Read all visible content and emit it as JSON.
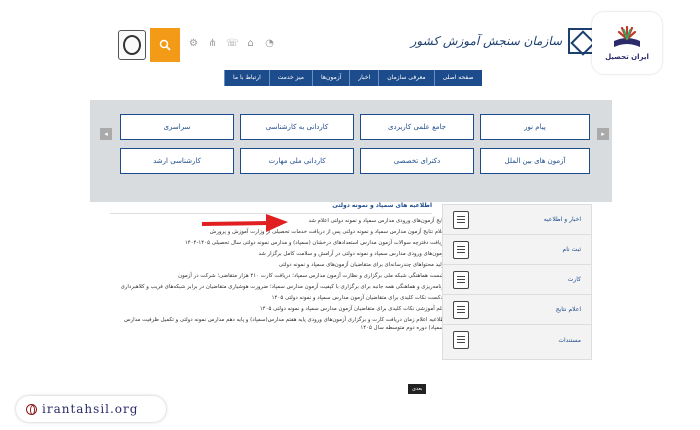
{
  "brand": {
    "name": "ایران تحصیل",
    "url": "irantahsil.org"
  },
  "header": {
    "logo_text": "سازمان سنجش آموزش کشور"
  },
  "nav": [
    "صفحه اصلی",
    "معرفی سازمان",
    "اخبار",
    "آزمون‌ها",
    "میز خدمت",
    "ارتباط با ما"
  ],
  "tiles": [
    [
      "پیام نور",
      "جامع علمی کاربردی",
      "کاردانی به کارشناسی",
      "سراسری"
    ],
    [
      "آزمون های بین الملل",
      "دکترای تخصصی",
      "کاردانی ملی مهارت",
      "کارشناسی ارشد"
    ]
  ],
  "section_title": "اطلاعیه های سمپاد و نمونه دولتی",
  "news": [
    "نتایج آزمون‌های ورودی مدارس سمپاد و نمونه دولتی اعلام شد",
    "اعلام نتایج آزمون مدارس سمپاد و نمونه دولتی پس از دریافت خدمات تحصیلی از وزارت آموزش و پرورش",
    "دریافت دفترچه سوالات آزمون مدارس استعدادهای درخشان (سمپاد) و مدارس نمونه دولتی سال تحصیلی ۱۴۰۵-۱۴۰۴",
    "آزمون‌های ورودی مدارس سمپاد و نمونه دولتی در آرامش و سلامت کامل برگزار شد",
    "تولید محتواهای چندرسانه‌ای برای متقاضیان آزمون‌های سمپاد و نمونه دولتی",
    "نشست هماهنگی شبکه ملی برگزاری و نظارت آزمون مدارس سمپاد؛ دریافت کارت ۴۱۰ هزار متقاضی؛ شرکت در آزمون",
    "برنامه‌ریزی و هماهنگی همه جانبه برای برگزاری با کیفیت آزمون مدارس سمپاد؛ ضرورت هوشیاری متقاضیان در برابر شبکه‌های فریب و کلاهبرداری",
    "یادکست نکات کلیدی برای متقاضیان آزمون مدارس سمپاد و نمونه دولتی ۱۴۰۵",
    "فیلم آموزشی نکات کلیدی برای متقاضیان آزمون مدارس سمپاد و نمونه دولتی ۱۴۰۵",
    "اطلاعیه اعلام زمان دریافت کارت و برگزاری آزمون‌های ورودی پایه هفتم مدارس(سمپاد) و پایه دهم مدارس نمونه دولتی و تکمیل ظرفیت مدارس (سمپاد) دوره دوم متوسطه سال ۱۴۰۵"
  ],
  "more_label": "بعدی",
  "sidebar": [
    {
      "label": "اخبار و اطلاعیه",
      "icon": "news-icon"
    },
    {
      "label": "ثبت نام",
      "icon": "register-icon"
    },
    {
      "label": "کارت",
      "icon": "card-icon"
    },
    {
      "label": "اعلام نتایج",
      "icon": "results-icon"
    },
    {
      "label": "مستندات",
      "icon": "documents-icon"
    }
  ],
  "colors": {
    "nav": "#1d4c8c",
    "accent": "#f39a17",
    "arrow": "#e02020"
  }
}
